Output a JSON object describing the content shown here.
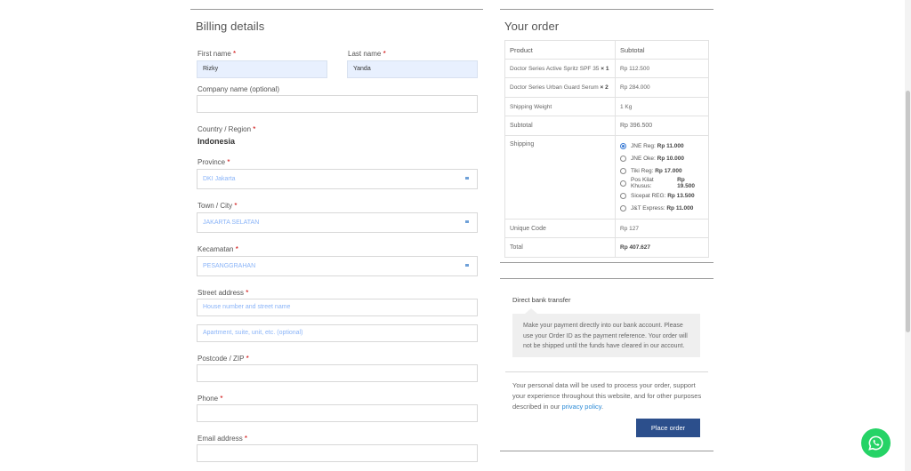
{
  "billing": {
    "title": "Billing details",
    "required_mark": "*",
    "first_name": {
      "label": "First name",
      "value": "Rizky"
    },
    "last_name": {
      "label": "Last name",
      "value": "Yanda"
    },
    "company": {
      "label": "Company name (optional)",
      "value": ""
    },
    "country": {
      "label": "Country / Region",
      "value": "Indonesia"
    },
    "province": {
      "label": "Province",
      "value": "DKI Jakarta"
    },
    "town": {
      "label": "Town / City",
      "value": "JAKARTA SELATAN"
    },
    "kecamatan": {
      "label": "Kecamatan",
      "value": "PESANGGRAHAN"
    },
    "street": {
      "label": "Street address",
      "placeholder1": "House number and street name",
      "placeholder2": "Apartment, suite, unit, etc. (optional)"
    },
    "postcode": {
      "label": "Postcode / ZIP",
      "value": ""
    },
    "phone": {
      "label": "Phone",
      "value": ""
    },
    "email": {
      "label": "Email address",
      "value": ""
    }
  },
  "order": {
    "title": "Your order",
    "col_product": "Product",
    "col_subtotal": "Subtotal",
    "items": [
      {
        "name": "Doctor Series Active Spritz SPF 35",
        "qty": "× 1",
        "price": "Rp 112.500"
      },
      {
        "name": "Doctor Series Urban Guard Serum",
        "qty": "× 2",
        "price": "Rp 284.000"
      }
    ],
    "shipping_weight_label": "Shipping Weight",
    "shipping_weight_value": "1 Kg",
    "subtotal_label": "Subtotal",
    "subtotal_value": "Rp 396.500",
    "shipping_label": "Shipping",
    "shipping_options": [
      {
        "name": "JNE Reg:",
        "price": "Rp 11.000",
        "selected": true
      },
      {
        "name": "JNE Oke:",
        "price": "Rp 10.000",
        "selected": false
      },
      {
        "name": "Tiki Reg:",
        "price": "Rp 17.000",
        "selected": false
      },
      {
        "name": "Pos Kilat Khusus:",
        "price": "Rp 19.500",
        "selected": false
      },
      {
        "name": "Sicepat REG:",
        "price": "Rp 13.500",
        "selected": false
      },
      {
        "name": "J&T Express:",
        "price": "Rp 11.000",
        "selected": false
      }
    ],
    "unique_code_label": "Unique Code",
    "unique_code_value": "Rp 127",
    "total_label": "Total",
    "total_value": "Rp 407.627"
  },
  "payment": {
    "method": "Direct bank transfer",
    "description": "Make your payment directly into our bank account. Please use your Order ID as the payment reference. Your order will not be shipped until the funds have cleared in our account.",
    "privacy_text": "Your personal data will be used to process your order, support your experience throughout this website, and for other purposes described in our",
    "privacy_link": "privacy policy",
    "privacy_end": ".",
    "place_order": "Place order"
  },
  "colors": {
    "accent": "#2c4f8c",
    "link": "#2b8ad6",
    "whatsapp": "#25d366",
    "autofill": "#e8f0fe"
  },
  "icons": {
    "whatsapp": "whatsapp-icon"
  }
}
